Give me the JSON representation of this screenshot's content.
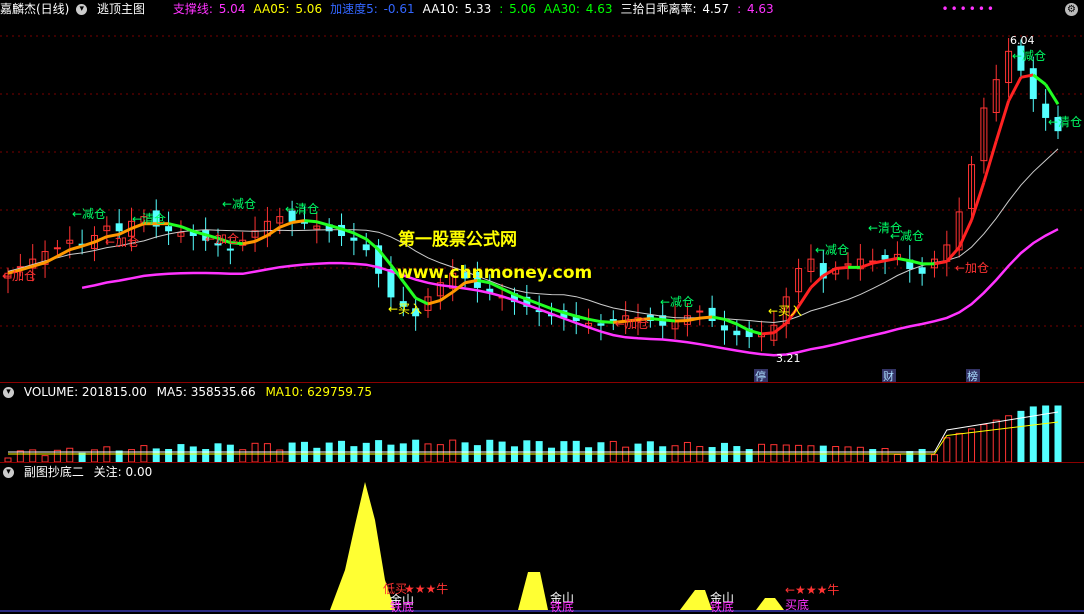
{
  "main": {
    "stock_name": "嘉麟杰(日线)",
    "formula_name": "逃顶主图",
    "indicators": [
      {
        "label": "支撑线:",
        "value": "5.04",
        "label_color": "#ff33ff",
        "value_color": "#ff33ff"
      },
      {
        "label": "AA05:",
        "value": "5.06",
        "label_color": "#ffff00",
        "value_color": "#ffff00"
      },
      {
        "label": "加速度5:",
        "value": "-0.61",
        "label_color": "#3366ff",
        "value_color": "#3366ff"
      },
      {
        "label": "AA10:",
        "value": "5.33",
        "label_color": "#ffffff",
        "value_color": "#ffffff"
      },
      {
        "label": ":",
        "value": "5.06",
        "label_color": "#00ff00",
        "value_color": "#00ff00"
      },
      {
        "label": "AA30:",
        "value": "4.63",
        "label_color": "#00ff00",
        "value_color": "#00ff00"
      },
      {
        "label": "三拾日乖离率:",
        "value": "4.57",
        "label_color": "#ffffff",
        "value_color": "#ffffff"
      },
      {
        "label": ":",
        "value": "4.63",
        "label_color": "#ff33ff",
        "value_color": "#ff33ff"
      }
    ],
    "dots": "••••••",
    "watermark_title": "第一股票公式网",
    "watermark_url": "www.chnmoney.com",
    "high_label": "6.04",
    "low_label": "3.21",
    "signals": [
      {
        "text": "←加仓",
        "color": "#ff3333"
      },
      {
        "text": "←减仓",
        "color": "#00ff66"
      },
      {
        "text": "←加仓",
        "color": "#ff3333"
      },
      {
        "text": "←清仓",
        "color": "#00ff66"
      },
      {
        "text": "←减仓",
        "color": "#00ff66"
      },
      {
        "text": "←加仓",
        "color": "#ff3333"
      },
      {
        "text": "←清仓",
        "color": "#00ff66"
      },
      {
        "text": "←买入",
        "color": "#ffff00"
      },
      {
        "text": "←加仓",
        "color": "#ff3333"
      },
      {
        "text": "←减仓",
        "color": "#00ff66"
      },
      {
        "text": "←买入",
        "color": "#ffff00"
      },
      {
        "text": "←减仓",
        "color": "#00ff66"
      },
      {
        "text": "←清仓",
        "color": "#00ff66"
      },
      {
        "text": "←减仓",
        "color": "#00ff66"
      },
      {
        "text": "←加仓",
        "color": "#ff3333"
      },
      {
        "text": "←减仓",
        "color": "#00ff66"
      },
      {
        "text": "←清仓",
        "color": "#00ff66"
      }
    ],
    "markers": [
      "停",
      "财",
      "榜"
    ]
  },
  "volume": {
    "label": "VOLUME: 201815.00",
    "ma5": "MA5: 358535.66",
    "ma10": "MA10: 629759.75"
  },
  "sub": {
    "label": "副图抄底二",
    "focus": "关注: 0.00",
    "tags": [
      {
        "text": "低买",
        "color": "#ff3333"
      },
      {
        "text": "★★★牛",
        "color": "#ff3333"
      },
      {
        "text": "金山",
        "color": "#ffffff"
      },
      {
        "text": "铁底",
        "color": "#ff33ff"
      },
      {
        "text": "金山",
        "color": "#ffffff"
      },
      {
        "text": "铁底",
        "color": "#ff33ff"
      },
      {
        "text": "金山",
        "color": "#ffffff"
      },
      {
        "text": "铁底",
        "color": "#ff33ff"
      },
      {
        "text": "←★★★牛",
        "color": "#ff3333"
      },
      {
        "text": "买底",
        "color": "#ff33ff"
      }
    ]
  },
  "chart_data": {
    "type": "candlestick",
    "close": [
      3.55,
      3.62,
      3.7,
      3.78,
      3.82,
      3.9,
      3.85,
      3.95,
      4.05,
      4.0,
      4.1,
      4.15,
      4.05,
      4.0,
      3.98,
      3.95,
      3.9,
      3.85,
      3.8,
      3.9,
      4.0,
      4.1,
      4.15,
      4.1,
      4.08,
      4.05,
      4.0,
      3.95,
      3.9,
      3.8,
      3.55,
      3.3,
      3.2,
      3.1,
      3.3,
      3.45,
      3.55,
      3.5,
      3.4,
      3.35,
      3.3,
      3.25,
      3.2,
      3.15,
      3.1,
      3.08,
      3.05,
      3.02,
      3.0,
      3.05,
      3.1,
      3.08,
      3.05,
      3.0,
      3.05,
      3.1,
      3.15,
      3.05,
      2.95,
      2.9,
      2.88,
      2.9,
      3.0,
      3.3,
      3.6,
      3.7,
      3.5,
      3.6,
      3.65,
      3.7,
      3.68,
      3.7,
      3.75,
      3.6,
      3.55,
      3.7,
      3.85,
      4.2,
      4.7,
      5.3,
      5.6,
      5.9,
      5.7,
      5.4,
      5.2,
      5.06
    ]
  }
}
